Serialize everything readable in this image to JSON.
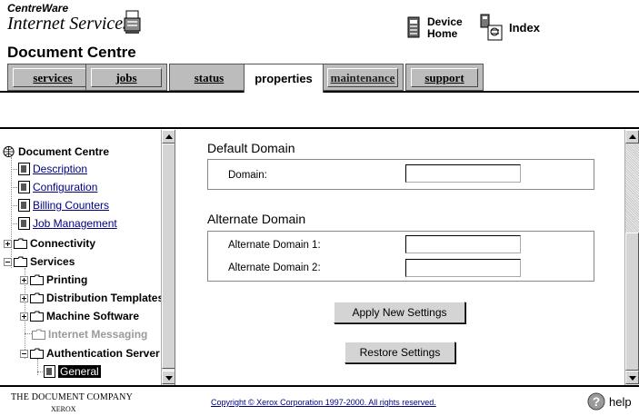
{
  "brand": {
    "line1": "CentreWare",
    "line2": "Internet Services",
    "product": "Document Centre"
  },
  "header_links": {
    "device_home_line1": "Device",
    "device_home_line2": "Home",
    "index": "Index"
  },
  "tabs": [
    {
      "label": "services"
    },
    {
      "label": "jobs"
    },
    {
      "label": "status"
    },
    {
      "label": "properties",
      "active": true
    },
    {
      "label": "maintenance"
    },
    {
      "label": "support"
    }
  ],
  "tree": {
    "root": "Document Centre",
    "items": [
      {
        "label": "Description",
        "type": "doc-link"
      },
      {
        "label": "Configuration",
        "type": "doc-link"
      },
      {
        "label": "Billing Counters",
        "type": "doc-link"
      },
      {
        "label": "Job Management",
        "type": "doc-link"
      },
      {
        "label": "Connectivity",
        "type": "folder-collapsed"
      },
      {
        "label": "Services",
        "type": "folder-expanded"
      },
      {
        "label": "Printing",
        "type": "folder-collapsed"
      },
      {
        "label": "Distribution Templates",
        "type": "folder-collapsed"
      },
      {
        "label": "Machine Software",
        "type": "folder-collapsed"
      },
      {
        "label": "Internet Messaging",
        "type": "folder-disabled"
      },
      {
        "label": "Authentication Server",
        "type": "folder-expanded"
      },
      {
        "label": "General",
        "type": "doc-selected"
      }
    ]
  },
  "content": {
    "default_domain": {
      "title": "Default Domain",
      "domain_label": "Domain:",
      "domain_value": ""
    },
    "alternate_domain": {
      "title": "Alternate Domain",
      "alt1_label": "Alternate Domain 1:",
      "alt1_value": "",
      "alt2_label": "Alternate Domain 2:",
      "alt2_value": ""
    },
    "apply_button": "Apply New Settings",
    "restore_button": "Restore Settings"
  },
  "footer": {
    "company_line1": "THE DOCUMENT COMPANY",
    "company_line2": "XEROX",
    "copyright": "Copyright © Xerox Corporation 1997-2000. All rights reserved.",
    "help": "help"
  },
  "colors": {
    "link": "#000080",
    "tab_bg": "#bcbcbc",
    "button_bg": "#d4d4d4"
  }
}
